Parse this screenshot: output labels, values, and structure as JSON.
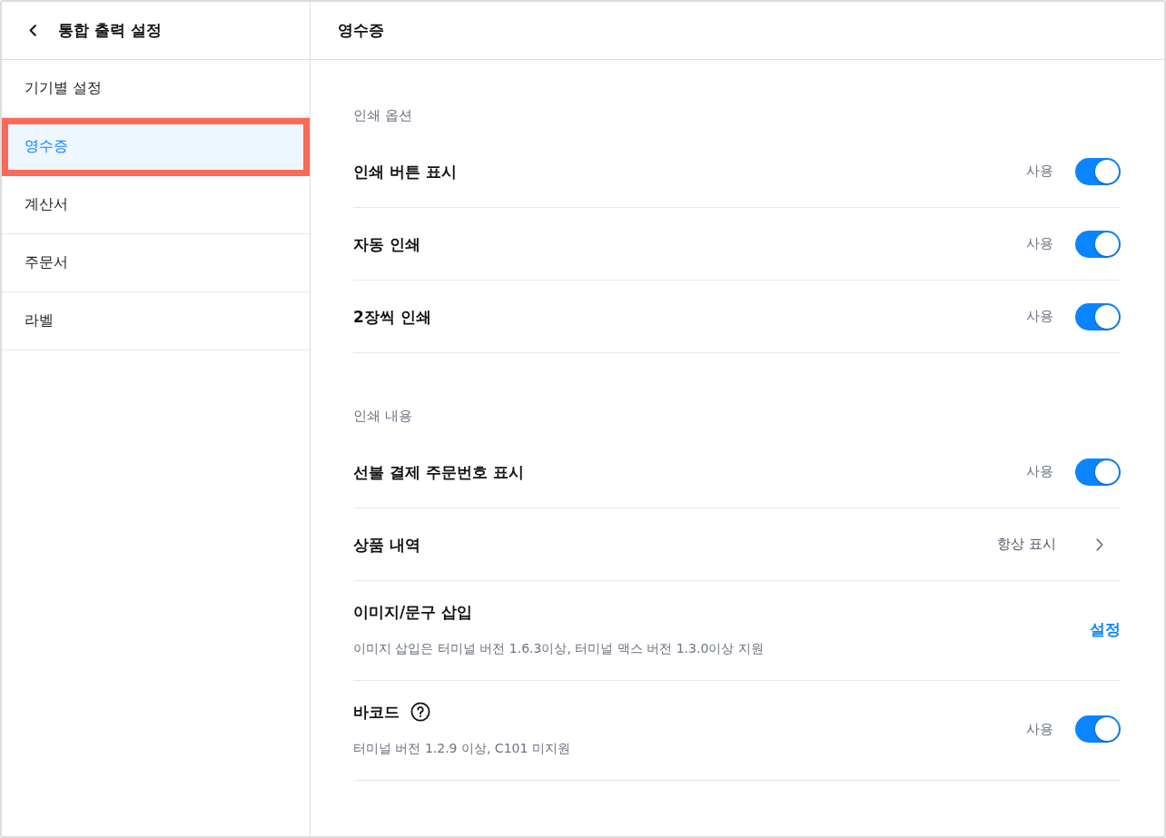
{
  "sidebar": {
    "title": "통합 출력 설정",
    "items": [
      {
        "label": "기기별 설정",
        "selected": false,
        "highlighted": false
      },
      {
        "label": "영수증",
        "selected": true,
        "highlighted": true
      },
      {
        "label": "계산서",
        "selected": false,
        "highlighted": false
      },
      {
        "label": "주문서",
        "selected": false,
        "highlighted": false
      },
      {
        "label": "라벨",
        "selected": false,
        "highlighted": false
      }
    ]
  },
  "panel": {
    "title": "영수증",
    "sections": [
      {
        "title": "인쇄 옵션",
        "rows": [
          {
            "kind": "toggle",
            "label": "인쇄 버튼 표시",
            "status": "사용",
            "on": true
          },
          {
            "kind": "toggle",
            "label": "자동 인쇄",
            "status": "사용",
            "on": true
          },
          {
            "kind": "toggle",
            "label": "2장씩 인쇄",
            "status": "사용",
            "on": true
          }
        ]
      },
      {
        "title": "인쇄 내용",
        "rows": [
          {
            "kind": "toggle",
            "label": "선불 결제 주문번호 표시",
            "status": "사용",
            "on": true
          },
          {
            "kind": "select",
            "label": "상품 내역",
            "value": "항상 표시"
          },
          {
            "kind": "link",
            "label": "이미지/문구 삽입",
            "description": "이미지 삽입은 터미널 버전 1.6.3이상, 터미널 맥스 버전 1.3.0이상 지원",
            "action": "설정"
          },
          {
            "kind": "toggle",
            "label": "바코드",
            "help": true,
            "description": "터미널 버전 1.2.9 이상, C101 미지원",
            "status": "사용",
            "on": true
          }
        ]
      }
    ]
  }
}
